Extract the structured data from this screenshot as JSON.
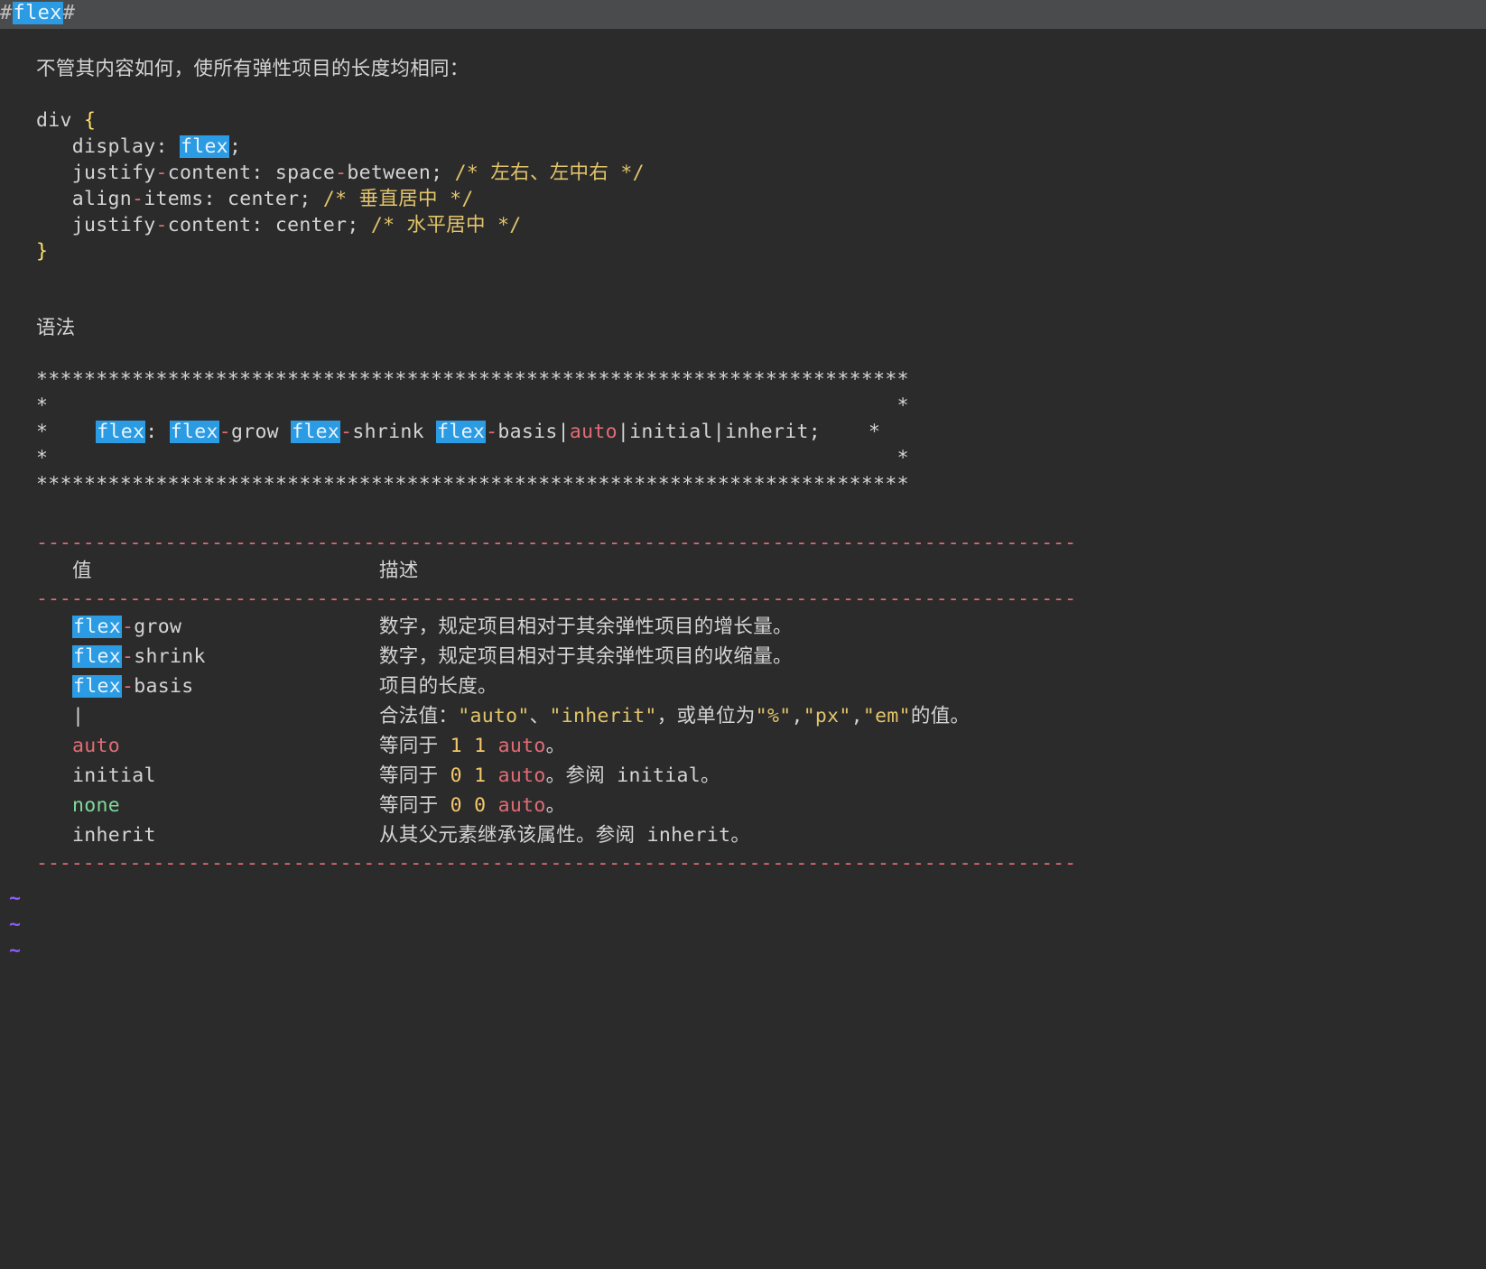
{
  "title": {
    "hash_l": "#",
    "key": "flex",
    "hash_r": "#"
  },
  "intro": "不管其内容如何，使所有弹性项目的长度均相同：",
  "code": {
    "sel": "div ",
    "brace_l": "{",
    "l1_prop": "display",
    "l1_val": "flex",
    "l1_semi": ";",
    "l2_prop_a": "justify",
    "l2_prop_b": "content",
    "l2_val": "space",
    "l2_val2": "between",
    "l2_semi": ";",
    "l2_c": "/* 左右、左中右 */",
    "l3_prop_a": "align",
    "l3_prop_b": "items",
    "l3_val": "center",
    "l3_semi": ";",
    "l3_c": "/* 垂直居中 */",
    "l4_prop_a": "justify",
    "l4_prop_b": "content",
    "l4_val": "center",
    "l4_semi": ";",
    "l4_c": "/* 水平居中 */",
    "brace_r": "}"
  },
  "syntax_heading": "语法",
  "box": {
    "top": "*************************************************************************",
    "edge_l": "*",
    "edge_r": "*",
    "flex": "flex",
    "colon": ":",
    "grow": "-grow",
    "shrink": "-shrink",
    "basis": "-basis",
    "pipe": "|",
    "auto": "auto",
    "rest": "|initial|inherit;",
    "bot": "*************************************************************************"
  },
  "table": {
    "dash": "-----------------------------------------------------------------------------------------",
    "h1": "值",
    "h2": "描述",
    "rows": [
      {
        "k_pre": "flex",
        "k_suf": "-grow",
        "v": "数字，规定项目相对于其余弹性项目的增长量。"
      },
      {
        "k_pre": "flex",
        "k_suf": "-shrink",
        "v": "数字，规定项目相对于其余弹性项目的收缩量。"
      },
      {
        "k_pre": "flex",
        "k_suf": "-basis",
        "v": "项目的长度。"
      },
      {
        "k_pipe": "|",
        "v_pre": "合法值：",
        "q1": "\"auto\"",
        "sep1": "、",
        "q2": "\"inherit\"",
        "mid": "，或单位为",
        "q3": "\"%\"",
        "c1": ",",
        "q4": "\"px\"",
        "c2": ",",
        "q5": "\"em\"",
        "tail": "的值。"
      },
      {
        "k_auto": "auto",
        "v_pre": "等同于 ",
        "n1": "1",
        "sp": " ",
        "n2": "1",
        "sp2": " ",
        "a": "auto",
        "tail": "。"
      },
      {
        "k_plain": "initial",
        "v_pre": "等同于 ",
        "n1": "0",
        "sp": " ",
        "n2": "1",
        "sp2": " ",
        "a": "auto",
        "tail": "。参阅 initial。"
      },
      {
        "k_none": "none",
        "v_pre": "等同于 ",
        "n1": "0",
        "sp": " ",
        "n2": "0",
        "sp2": " ",
        "a": "auto",
        "tail": "。"
      },
      {
        "k_plain": "inherit",
        "v_plain": "从其父元素继承该属性。参阅 inherit。"
      }
    ]
  },
  "tilde": "~"
}
